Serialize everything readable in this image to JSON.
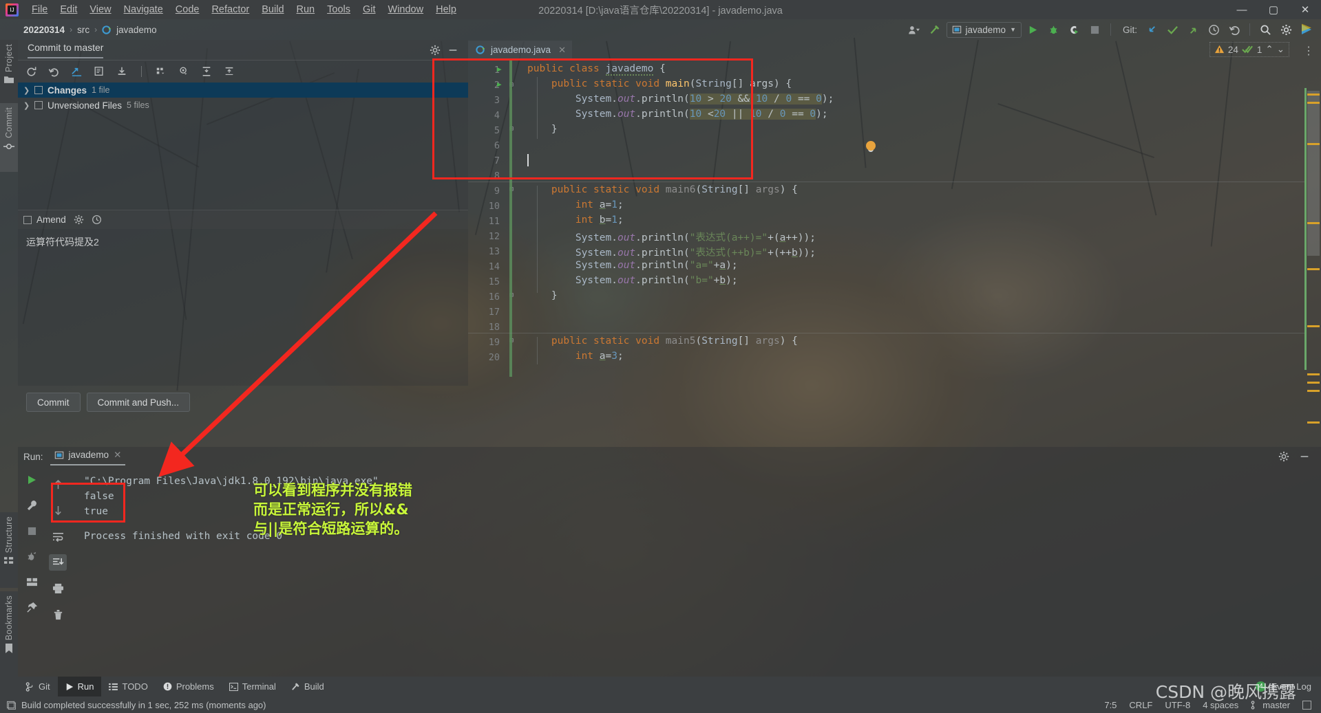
{
  "window": {
    "title": "20220314 [D:\\java语言仓库\\20220314] - javademo.java",
    "minimize": "—",
    "maximize": "▢",
    "close": "✕"
  },
  "menu": {
    "items": [
      "File",
      "Edit",
      "View",
      "Navigate",
      "Code",
      "Refactor",
      "Build",
      "Run",
      "Tools",
      "Git",
      "Window",
      "Help"
    ]
  },
  "breadcrumb": {
    "project": "20220314",
    "folder": "src",
    "file": "javademo",
    "sep": "›"
  },
  "toolbar": {
    "run_config": "javademo",
    "git_label": "Git:",
    "icons": [
      "user-icon",
      "build-hammer-icon",
      "run-icon",
      "debug-icon",
      "coverage-icon",
      "stop-icon",
      "git-update-icon",
      "git-commit-icon",
      "git-push-icon",
      "history-icon",
      "rollback-icon",
      "search-icon",
      "settings-icon",
      "ide-help-icon"
    ]
  },
  "left_strips": {
    "project": "Project",
    "commit": "Commit",
    "structure": "Structure",
    "bookmarks": "Bookmarks"
  },
  "commit_panel": {
    "title": "Commit to master",
    "toolbar_icons": [
      "refresh-icon",
      "rollback-icon",
      "diff-icon",
      "show-diff-icon",
      "shelve-icon",
      "group-by-icon",
      "preview-icon",
      "expand-all-icon",
      "collapse-all-icon"
    ],
    "rows": [
      {
        "label": "Changes",
        "count": "1 file",
        "bold": true,
        "selected": true
      },
      {
        "label": "Unversioned Files",
        "count": "5 files",
        "bold": false,
        "selected": false
      }
    ],
    "amend_label": "Amend",
    "message": "运算符代码提及2",
    "buttons": [
      "Commit",
      "Commit and Push..."
    ]
  },
  "editor": {
    "tab": {
      "label": "javademo.java",
      "close": "✕"
    },
    "inspections": {
      "warn_count": "24",
      "ok_count": "1",
      "up": "⌃",
      "down": "⌄"
    },
    "lines": [
      {
        "n": 1,
        "text": "public class javademo {"
      },
      {
        "n": 2,
        "text": "    public static void main(String[] args) {"
      },
      {
        "n": 3,
        "text": "        System.out.println(10 > 20 && 10 / 0 == 0);"
      },
      {
        "n": 4,
        "text": "        System.out.println(10 <20 || 10 / 0 == 0);"
      },
      {
        "n": 5,
        "text": "    }"
      },
      {
        "n": 6,
        "text": ""
      },
      {
        "n": 7,
        "text": ""
      },
      {
        "n": 8,
        "text": ""
      },
      {
        "n": 9,
        "text": "    public static void main6(String[] args) {"
      },
      {
        "n": 10,
        "text": "        int a=1;"
      },
      {
        "n": 11,
        "text": "        int b=1;"
      },
      {
        "n": 12,
        "text": "        System.out.println(\"表达式(a++)=\"+(a++));"
      },
      {
        "n": 13,
        "text": "        System.out.println(\"表达式(++b)=\"+(++b));"
      },
      {
        "n": 14,
        "text": "        System.out.println(\"a=\"+a);"
      },
      {
        "n": 15,
        "text": "        System.out.println(\"b=\"+b);"
      },
      {
        "n": 16,
        "text": "    }"
      },
      {
        "n": 17,
        "text": ""
      },
      {
        "n": 18,
        "text": ""
      },
      {
        "n": 19,
        "text": "    public static void main5(String[] args) {"
      },
      {
        "n": 20,
        "text": "        int a=3;"
      }
    ]
  },
  "run_panel": {
    "label": "Run:",
    "tab": "javademo",
    "tab_close": "✕",
    "side_icons": [
      "rerun-icon",
      "settings-wrench-icon",
      "stop-icon",
      "kill-process-icon",
      "layout-icon",
      "pin-icon"
    ],
    "side_icons2": [
      "scroll-up-icon",
      "scroll-down-icon",
      "soft-wrap-icon",
      "scroll-to-end-icon",
      "print-icon",
      "trash-icon"
    ],
    "header_right": [
      "settings-gear-icon",
      "minimize-icon"
    ],
    "console": [
      "\"C:\\Program Files\\Java\\jdk1.8.0_192\\bin\\java.exe\" ...",
      "false",
      "true",
      "Process finished with exit code 0"
    ]
  },
  "annotation": {
    "lines": [
      "可以看到程序并没有报错",
      "而是正常运行，所以&&",
      "与||是符合短路运算的。"
    ],
    "color": "#c8f63a",
    "arrow_color": "#f3271f",
    "box_color": "#f3271f"
  },
  "bottom_tools": [
    {
      "label": "Git",
      "icon": "git-branch-icon",
      "selected": false
    },
    {
      "label": "Run",
      "icon": "run-icon",
      "selected": true
    },
    {
      "label": "TODO",
      "icon": "todo-list-icon",
      "selected": false
    },
    {
      "label": "Problems",
      "icon": "problems-icon",
      "selected": false
    },
    {
      "label": "Terminal",
      "icon": "terminal-icon",
      "selected": false
    },
    {
      "label": "Build",
      "icon": "build-hammer-icon",
      "selected": false
    }
  ],
  "status": {
    "message": "Build completed successfully in 1 sec, 252 ms (moments ago)",
    "caret": "7:5",
    "line_sep": "CRLF",
    "encoding": "UTF-8",
    "indent": "4 spaces",
    "branch": "master",
    "event_log": "Event Log",
    "event_count": "4"
  },
  "watermark": "CSDN @晚风携露"
}
